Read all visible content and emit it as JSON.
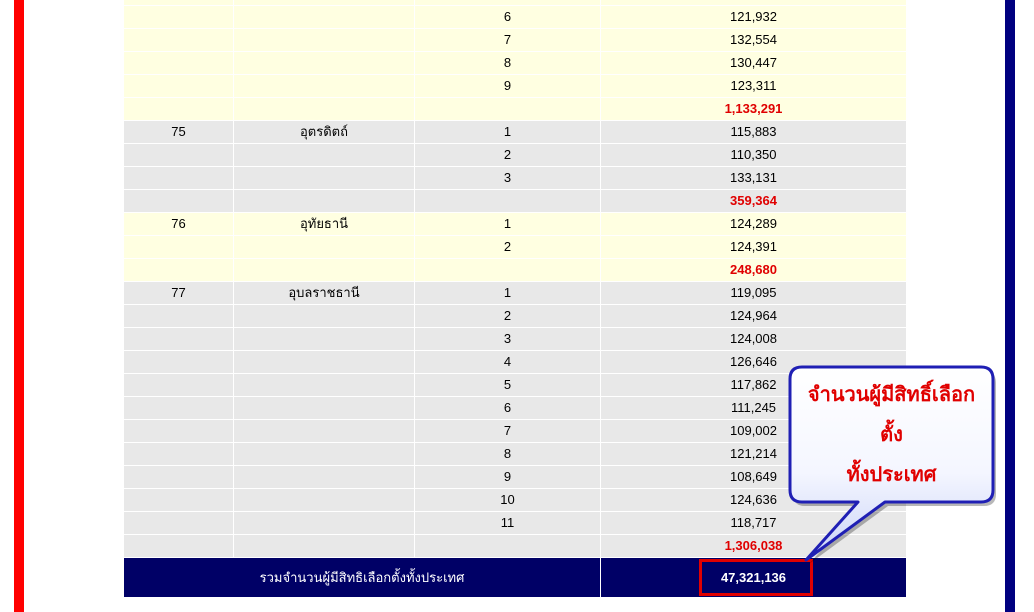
{
  "colors": {
    "row_band_a": "#ffffe1",
    "row_band_b": "#e8e8e8",
    "subtotal_text": "#e00000",
    "total_row": "#000066",
    "total_text": "#ffffff",
    "highlight_box": "#e00000",
    "callout_border": "#1f1fb4",
    "callout_text": "#e00000",
    "left_bar": "#ff0000",
    "right_bar": "#000080"
  },
  "table": {
    "groups": [
      {
        "districts": [
          {
            "district": "6",
            "voters": "121,932"
          },
          {
            "district": "7",
            "voters": "132,554"
          },
          {
            "district": "8",
            "voters": "130,447"
          },
          {
            "district": "9",
            "voters": "123,311"
          }
        ],
        "subtotal": "1,133,291"
      },
      {
        "no": "75",
        "province": "อุตรดิตถ์",
        "districts": [
          {
            "district": "1",
            "voters": "115,883"
          },
          {
            "district": "2",
            "voters": "110,350"
          },
          {
            "district": "3",
            "voters": "133,131"
          }
        ],
        "subtotal": "359,364"
      },
      {
        "no": "76",
        "province": "อุทัยธานี",
        "districts": [
          {
            "district": "1",
            "voters": "124,289"
          },
          {
            "district": "2",
            "voters": "124,391"
          }
        ],
        "subtotal": "248,680"
      },
      {
        "no": "77",
        "province": "อุบลราชธานี",
        "districts": [
          {
            "district": "1",
            "voters": "119,095"
          },
          {
            "district": "2",
            "voters": "124,964"
          },
          {
            "district": "3",
            "voters": "124,008"
          },
          {
            "district": "4",
            "voters": "126,646"
          },
          {
            "district": "5",
            "voters": "117,862"
          },
          {
            "district": "6",
            "voters": "111,245"
          },
          {
            "district": "7",
            "voters": "109,002"
          },
          {
            "district": "8",
            "voters": "121,214"
          },
          {
            "district": "9",
            "voters": "108,649"
          },
          {
            "district": "10",
            "voters": "124,636"
          },
          {
            "district": "11",
            "voters": "118,717"
          }
        ],
        "subtotal": "1,306,038"
      }
    ],
    "total": {
      "label": "รวมจำนวนผู้มีสิทธิเลือกตั้งทั้งประเทศ",
      "value": "47,321,136"
    }
  },
  "callout": {
    "lines": [
      "จำนวนผู้มีสิทธิ์เลือก",
      "ตั้ง",
      "ทั้งประเทศ"
    ]
  }
}
